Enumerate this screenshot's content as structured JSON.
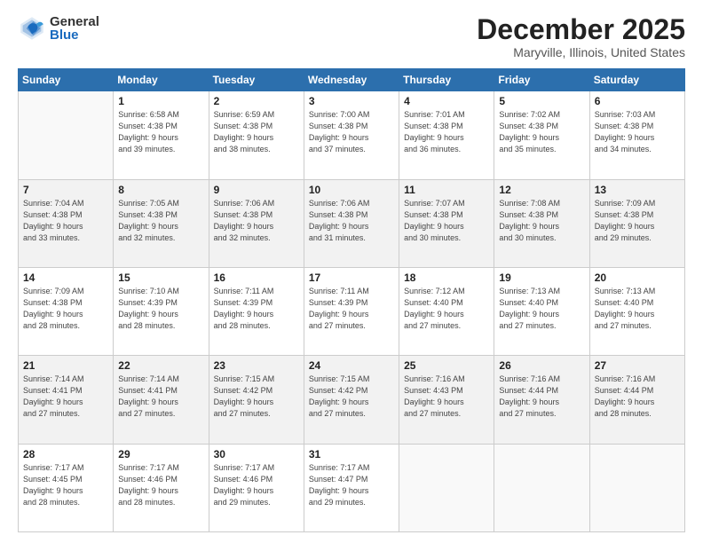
{
  "logo": {
    "general": "General",
    "blue": "Blue"
  },
  "header": {
    "month": "December 2025",
    "location": "Maryville, Illinois, United States"
  },
  "weekdays": [
    "Sunday",
    "Monday",
    "Tuesday",
    "Wednesday",
    "Thursday",
    "Friday",
    "Saturday"
  ],
  "weeks": [
    [
      {
        "day": "",
        "info": ""
      },
      {
        "day": "1",
        "info": "Sunrise: 6:58 AM\nSunset: 4:38 PM\nDaylight: 9 hours\nand 39 minutes."
      },
      {
        "day": "2",
        "info": "Sunrise: 6:59 AM\nSunset: 4:38 PM\nDaylight: 9 hours\nand 38 minutes."
      },
      {
        "day": "3",
        "info": "Sunrise: 7:00 AM\nSunset: 4:38 PM\nDaylight: 9 hours\nand 37 minutes."
      },
      {
        "day": "4",
        "info": "Sunrise: 7:01 AM\nSunset: 4:38 PM\nDaylight: 9 hours\nand 36 minutes."
      },
      {
        "day": "5",
        "info": "Sunrise: 7:02 AM\nSunset: 4:38 PM\nDaylight: 9 hours\nand 35 minutes."
      },
      {
        "day": "6",
        "info": "Sunrise: 7:03 AM\nSunset: 4:38 PM\nDaylight: 9 hours\nand 34 minutes."
      }
    ],
    [
      {
        "day": "7",
        "info": "Sunrise: 7:04 AM\nSunset: 4:38 PM\nDaylight: 9 hours\nand 33 minutes."
      },
      {
        "day": "8",
        "info": "Sunrise: 7:05 AM\nSunset: 4:38 PM\nDaylight: 9 hours\nand 32 minutes."
      },
      {
        "day": "9",
        "info": "Sunrise: 7:06 AM\nSunset: 4:38 PM\nDaylight: 9 hours\nand 32 minutes."
      },
      {
        "day": "10",
        "info": "Sunrise: 7:06 AM\nSunset: 4:38 PM\nDaylight: 9 hours\nand 31 minutes."
      },
      {
        "day": "11",
        "info": "Sunrise: 7:07 AM\nSunset: 4:38 PM\nDaylight: 9 hours\nand 30 minutes."
      },
      {
        "day": "12",
        "info": "Sunrise: 7:08 AM\nSunset: 4:38 PM\nDaylight: 9 hours\nand 30 minutes."
      },
      {
        "day": "13",
        "info": "Sunrise: 7:09 AM\nSunset: 4:38 PM\nDaylight: 9 hours\nand 29 minutes."
      }
    ],
    [
      {
        "day": "14",
        "info": "Sunrise: 7:09 AM\nSunset: 4:38 PM\nDaylight: 9 hours\nand 28 minutes."
      },
      {
        "day": "15",
        "info": "Sunrise: 7:10 AM\nSunset: 4:39 PM\nDaylight: 9 hours\nand 28 minutes."
      },
      {
        "day": "16",
        "info": "Sunrise: 7:11 AM\nSunset: 4:39 PM\nDaylight: 9 hours\nand 28 minutes."
      },
      {
        "day": "17",
        "info": "Sunrise: 7:11 AM\nSunset: 4:39 PM\nDaylight: 9 hours\nand 27 minutes."
      },
      {
        "day": "18",
        "info": "Sunrise: 7:12 AM\nSunset: 4:40 PM\nDaylight: 9 hours\nand 27 minutes."
      },
      {
        "day": "19",
        "info": "Sunrise: 7:13 AM\nSunset: 4:40 PM\nDaylight: 9 hours\nand 27 minutes."
      },
      {
        "day": "20",
        "info": "Sunrise: 7:13 AM\nSunset: 4:40 PM\nDaylight: 9 hours\nand 27 minutes."
      }
    ],
    [
      {
        "day": "21",
        "info": "Sunrise: 7:14 AM\nSunset: 4:41 PM\nDaylight: 9 hours\nand 27 minutes."
      },
      {
        "day": "22",
        "info": "Sunrise: 7:14 AM\nSunset: 4:41 PM\nDaylight: 9 hours\nand 27 minutes."
      },
      {
        "day": "23",
        "info": "Sunrise: 7:15 AM\nSunset: 4:42 PM\nDaylight: 9 hours\nand 27 minutes."
      },
      {
        "day": "24",
        "info": "Sunrise: 7:15 AM\nSunset: 4:42 PM\nDaylight: 9 hours\nand 27 minutes."
      },
      {
        "day": "25",
        "info": "Sunrise: 7:16 AM\nSunset: 4:43 PM\nDaylight: 9 hours\nand 27 minutes."
      },
      {
        "day": "26",
        "info": "Sunrise: 7:16 AM\nSunset: 4:44 PM\nDaylight: 9 hours\nand 27 minutes."
      },
      {
        "day": "27",
        "info": "Sunrise: 7:16 AM\nSunset: 4:44 PM\nDaylight: 9 hours\nand 28 minutes."
      }
    ],
    [
      {
        "day": "28",
        "info": "Sunrise: 7:17 AM\nSunset: 4:45 PM\nDaylight: 9 hours\nand 28 minutes."
      },
      {
        "day": "29",
        "info": "Sunrise: 7:17 AM\nSunset: 4:46 PM\nDaylight: 9 hours\nand 28 minutes."
      },
      {
        "day": "30",
        "info": "Sunrise: 7:17 AM\nSunset: 4:46 PM\nDaylight: 9 hours\nand 29 minutes."
      },
      {
        "day": "31",
        "info": "Sunrise: 7:17 AM\nSunset: 4:47 PM\nDaylight: 9 hours\nand 29 minutes."
      },
      {
        "day": "",
        "info": ""
      },
      {
        "day": "",
        "info": ""
      },
      {
        "day": "",
        "info": ""
      }
    ]
  ]
}
